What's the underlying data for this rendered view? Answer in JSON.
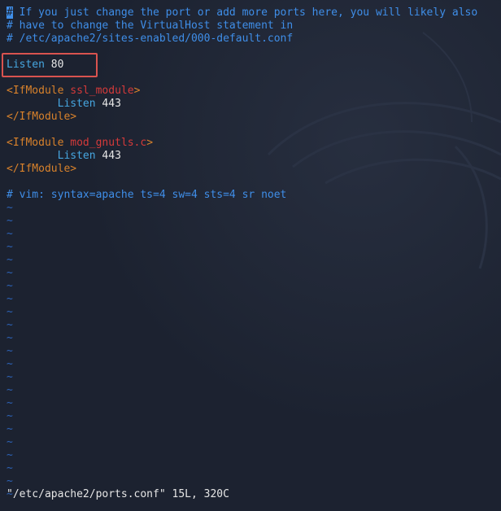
{
  "editor": {
    "comment_lines": [
      " If you just change the port or add more ports here, you will likely also",
      "# have to change the VirtualHost statement in",
      "# /etc/apache2/sites-enabled/000-default.conf"
    ],
    "cursor_char": "#",
    "listen_line": {
      "keyword": "Listen",
      "value": "80"
    },
    "block_ssl": {
      "open_tag": "<IfModule",
      "module": "ssl_module",
      "open_tag_end": ">",
      "listen_keyword": "Listen",
      "listen_value": "443",
      "close_tag": "</IfModule>"
    },
    "block_gnutls": {
      "open_tag": "<IfModule",
      "module": "mod_gnutls.c",
      "open_tag_end": ">",
      "listen_keyword": "Listen",
      "listen_value": "443",
      "close_tag": "</IfModule>"
    },
    "modeline": "# vim: syntax=apache ts=4 sw=4 sts=4 sr noet",
    "tilde_char": "~",
    "tilde_count": 23
  },
  "status_bar": {
    "text": "\"/etc/apache2/ports.conf\" 15L, 320C"
  },
  "colors": {
    "background": "#1c2230",
    "comment": "#3f8ee8",
    "directive": "#46a6e0",
    "tag": "#d9822b",
    "module": "#d53a3a",
    "tilde": "#2d63b8",
    "highlight": "#d9534f"
  }
}
